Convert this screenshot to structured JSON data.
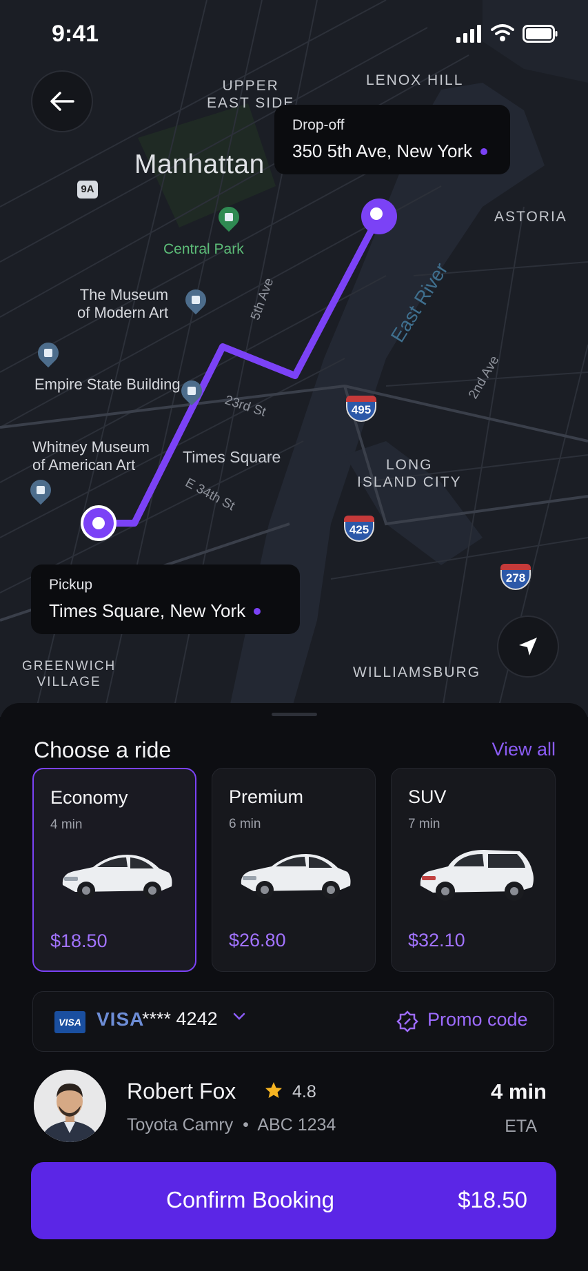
{
  "status_bar": {
    "time": "9:41"
  },
  "map": {
    "labels": {
      "upper_east_side_1": "UPPER",
      "upper_east_side_2": "EAST SIDE",
      "lenox_hill": "LENOX HILL",
      "manhattan": "Manhattan",
      "astoria": "ASTORIA",
      "central_park": "Central Park",
      "moma_1": "The Museum",
      "moma_2": "of Modern Art",
      "empire_state": "Empire State Building",
      "whitney_1": "Whitney Museum",
      "whitney_2": "of American Art",
      "times_square": "Times Square",
      "long_island_1": "LONG",
      "long_island_2": "ISLAND CITY",
      "greenwich_1": "GREENWICH",
      "greenwich_2": "VILLAGE",
      "williamsburg": "WILLIAMSBURG",
      "east_river": "East River",
      "fifth_ave": "5th Ave",
      "e34": "E 34th St",
      "second_ave": "2nd Ave",
      "third_st": "23rd St",
      "shield_9a": "9A",
      "shield_495": "495",
      "shield_425": "425",
      "shield_278": "278"
    },
    "dropoff": {
      "caption": "Drop-off",
      "address": "350 5th Ave, New York"
    },
    "pickup": {
      "caption": "Pickup",
      "address": "Times Square, New York"
    },
    "route_color": "#7b42f6"
  },
  "sheet": {
    "title": "Choose a ride",
    "view_all": "View all",
    "rides": [
      {
        "name": "Economy",
        "eta": "4 min",
        "price": "$18.50",
        "selected": true
      },
      {
        "name": "Premium",
        "eta": "6 min",
        "price": "$26.80",
        "selected": false
      },
      {
        "name": "SUV",
        "eta": "7 min",
        "price": "$32.10",
        "selected": false
      }
    ],
    "payment": {
      "badge": "VISA",
      "brand": "VISA",
      "card": "**** 4242",
      "promo": "Promo code"
    },
    "driver": {
      "name": "Robert Fox",
      "rating": "4.8",
      "car": "Toyota Camry",
      "plate": "ABC 1234",
      "car_info": "Toyota Camry  •  ABC 1234",
      "eta": "4 min",
      "eta_label": "ETA"
    },
    "confirm": {
      "label": "Confirm Booking",
      "price": "$18.50"
    }
  },
  "colors": {
    "accent": "#7b42f6",
    "button": "#5b26e6",
    "background": "#0d0e12"
  }
}
